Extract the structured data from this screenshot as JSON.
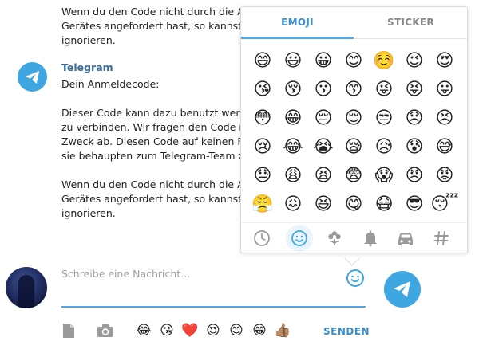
{
  "messages": {
    "top_fragment": [
      "Wenn du den Code nicht durch die Anr",
      "Gerätes angefordert hast, so kannst du",
      "ignorieren."
    ],
    "telegram": {
      "sender": "Telegram",
      "lines": [
        "Dein Anmeldecode:",
        "",
        "Dieser Code kann dazu benutzt werde",
        "zu verbinden. Wir fragen den Code nie",
        "Zweck ab. Diesen Code auf keinen Fall",
        "sie behaupten zum Telegram-Team zu",
        "",
        "Wenn du den Code nicht durch die Anr",
        "Gerätes angefordert hast, so kannst du",
        "ignorieren."
      ]
    }
  },
  "composer": {
    "placeholder": "Schreibe eine Nachricht...",
    "send_label": "SENDEN",
    "quick_emoji": [
      "😂",
      "😘",
      "❤️",
      "😍",
      "😊",
      "😁",
      "👍🏽"
    ]
  },
  "emoji_panel": {
    "tabs": [
      "EMOJI",
      "STICKER"
    ],
    "active_tab": "EMOJI",
    "emojis": [
      "😄",
      "😃",
      "😀",
      "😊",
      "☺️",
      "😉",
      "😍",
      "😘",
      "😚",
      "😗",
      "😙",
      "😜",
      "😝",
      "😛",
      "😳",
      "😁",
      "😔",
      "😌",
      "😒",
      "😞",
      "😣",
      "😢",
      "😂",
      "😭",
      "😪",
      "😥",
      "😰",
      "😅",
      "😓",
      "😩",
      "😫",
      "😨",
      "😱",
      "😠",
      "😡",
      "😤",
      "😖",
      "😆",
      "😋",
      "😷",
      "😎",
      "😴",
      "😵",
      "😲",
      "😟",
      "😦",
      "😧",
      "😈",
      "👿"
    ],
    "categories": [
      "clock-icon",
      "smiley-icon",
      "flower-icon",
      "bell-icon",
      "car-icon",
      "hash-icon"
    ],
    "active_category": "smiley-icon"
  },
  "colors": {
    "accent": "#3ea6e1",
    "link_blue": "#3a8fd1",
    "sender_blue": "#3a6d99"
  }
}
